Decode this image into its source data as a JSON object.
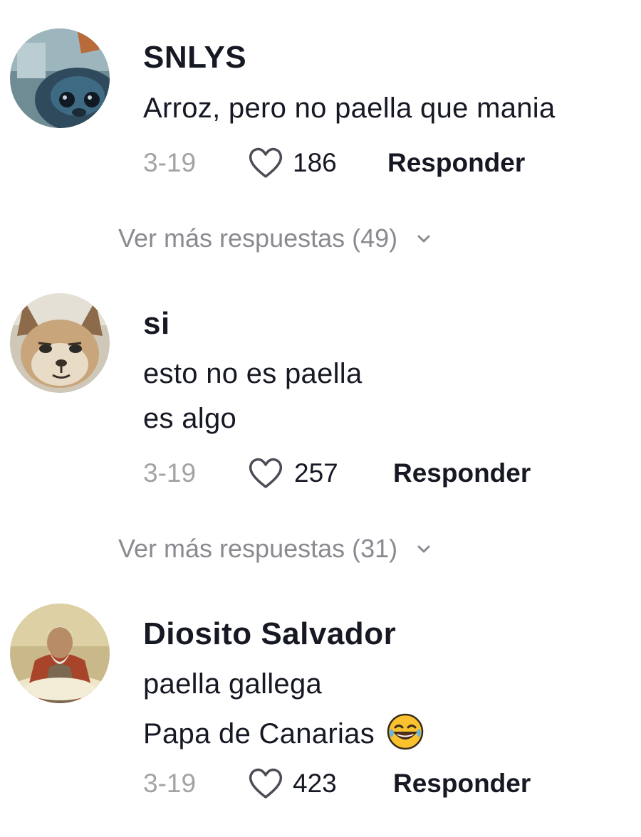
{
  "comments": [
    {
      "username": "SNLYS",
      "lines": [
        "Arroz, pero no paella que mania"
      ],
      "date": "3-19",
      "likes": "186",
      "reply_label": "Responder",
      "more_replies": "Ver más respuestas (49)",
      "avatar_icon": "stitch-avatar"
    },
    {
      "username": "si",
      "lines": [
        "esto no es paella",
        "es algo"
      ],
      "date": "3-19",
      "likes": "257",
      "reply_label": "Responder",
      "more_replies": "Ver más respuestas (31)",
      "avatar_icon": "caracal-avatar"
    },
    {
      "username": "Diosito Salvador",
      "lines": [
        "paella gallega",
        "Papa de Canarias"
      ],
      "emoji": "tears-of-joy-emoji",
      "date": "3-19",
      "likes": "423",
      "reply_label": "Responder",
      "avatar_icon": "god-painting-avatar"
    }
  ],
  "colors": {
    "text": "#161823",
    "secondary": "#a3a3a7",
    "more_replies": "#8a8b91"
  }
}
